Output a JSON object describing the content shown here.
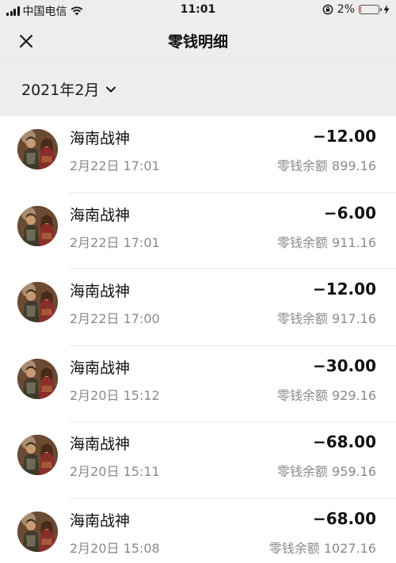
{
  "status_bar": {
    "carrier": "中国电信",
    "time": "11:01",
    "battery_pct": "2%",
    "battery_level": 0.02
  },
  "nav": {
    "title": "零钱明细"
  },
  "month": {
    "label": "2021年2月"
  },
  "transactions": [
    {
      "name": "海南战神",
      "time": "2月22日 17:01",
      "amount": "−12.00",
      "balance": "零钱余额 899.16"
    },
    {
      "name": "海南战神",
      "time": "2月22日 17:01",
      "amount": "−6.00",
      "balance": "零钱余额 911.16"
    },
    {
      "name": "海南战神",
      "time": "2月22日 17:00",
      "amount": "−12.00",
      "balance": "零钱余额 917.16"
    },
    {
      "name": "海南战神",
      "time": "2月20日 15:12",
      "amount": "−30.00",
      "balance": "零钱余额 929.16"
    },
    {
      "name": "海南战神",
      "time": "2月20日 15:11",
      "amount": "−68.00",
      "balance": "零钱余额 959.16"
    },
    {
      "name": "海南战神",
      "time": "2月20日 15:08",
      "amount": "−68.00",
      "balance": "零钱余额 1027.16"
    }
  ],
  "icons": {
    "close": "close-icon",
    "chevron": "chevron-down-icon",
    "wifi": "wifi-icon",
    "lock": "orientation-lock-icon",
    "battery": "battery-icon",
    "charging": "charging-bolt-icon"
  },
  "colors": {
    "background": "#ededed",
    "list_bg": "#ffffff",
    "secondary_text": "#8a8a8a",
    "battery_low": "#e53935"
  }
}
